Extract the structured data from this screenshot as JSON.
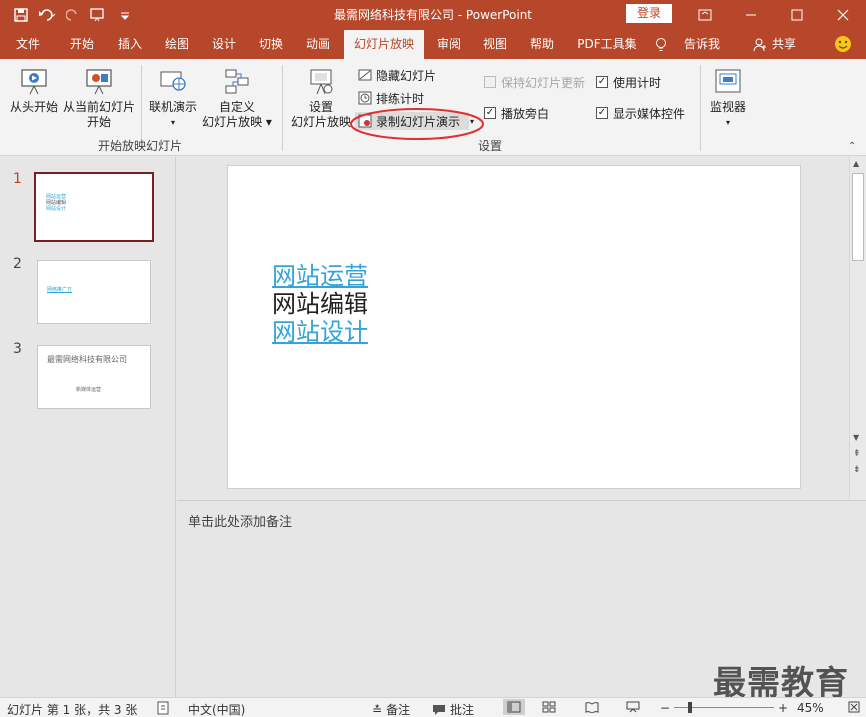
{
  "window": {
    "title": "最需网络科技有限公司  -  PowerPoint",
    "login_label": "登录",
    "controls": [
      "restore-ribbon",
      "minimize",
      "maximize",
      "close"
    ]
  },
  "tabs": [
    {
      "label": "文件"
    },
    {
      "label": "开始"
    },
    {
      "label": "插入"
    },
    {
      "label": "绘图"
    },
    {
      "label": "设计"
    },
    {
      "label": "切换"
    },
    {
      "label": "动画"
    },
    {
      "label": "幻灯片放映"
    },
    {
      "label": "审阅"
    },
    {
      "label": "视图"
    },
    {
      "label": "帮助"
    },
    {
      "label": "PDF工具集"
    },
    {
      "label": "告诉我"
    },
    {
      "label": "共享"
    }
  ],
  "ribbon": {
    "group1": {
      "from_start": "从头开始",
      "from_current_line1": "从当前幻灯片",
      "from_current_line2": "开始",
      "online": "联机演示",
      "custom_line1": "自定义",
      "custom_line2": "幻灯片放映",
      "label": "开始放映幻灯片"
    },
    "group2": {
      "setup_line1": "设置",
      "setup_line2": "幻灯片放映",
      "hide_slide": "隐藏幻灯片",
      "rehearse": "排练计时",
      "record": "录制幻灯片演示",
      "keep_updated": "保持幻灯片更新",
      "play_narration": "播放旁白",
      "use_timings": "使用计时",
      "show_media": "显示媒体控件",
      "label": "设置"
    },
    "group3": {
      "monitor": "监视器"
    }
  },
  "slides": [
    {
      "number": "1",
      "preview_lines": [
        "网站运营",
        "网站编辑",
        "网站设计"
      ]
    },
    {
      "number": "2",
      "preview_lines": [
        "网络推广方"
      ]
    },
    {
      "number": "3",
      "preview_lines": [
        "最需网络科技有限公司",
        "新媒体运营"
      ]
    }
  ],
  "current_slide": {
    "lines": [
      "网站运营",
      "网站编辑",
      "网站设计"
    ]
  },
  "notes": {
    "placeholder": "单击此处添加备注"
  },
  "status": {
    "slide_info": "幻灯片 第 1 张，共 3 张",
    "language": "中文(中国)",
    "notes": "备注",
    "comments": "批注",
    "zoom": "45%"
  },
  "watermark": "最需教育",
  "colors": {
    "accent": "#b7472a",
    "link": "#34a4d8",
    "annotation": "#e03030"
  }
}
